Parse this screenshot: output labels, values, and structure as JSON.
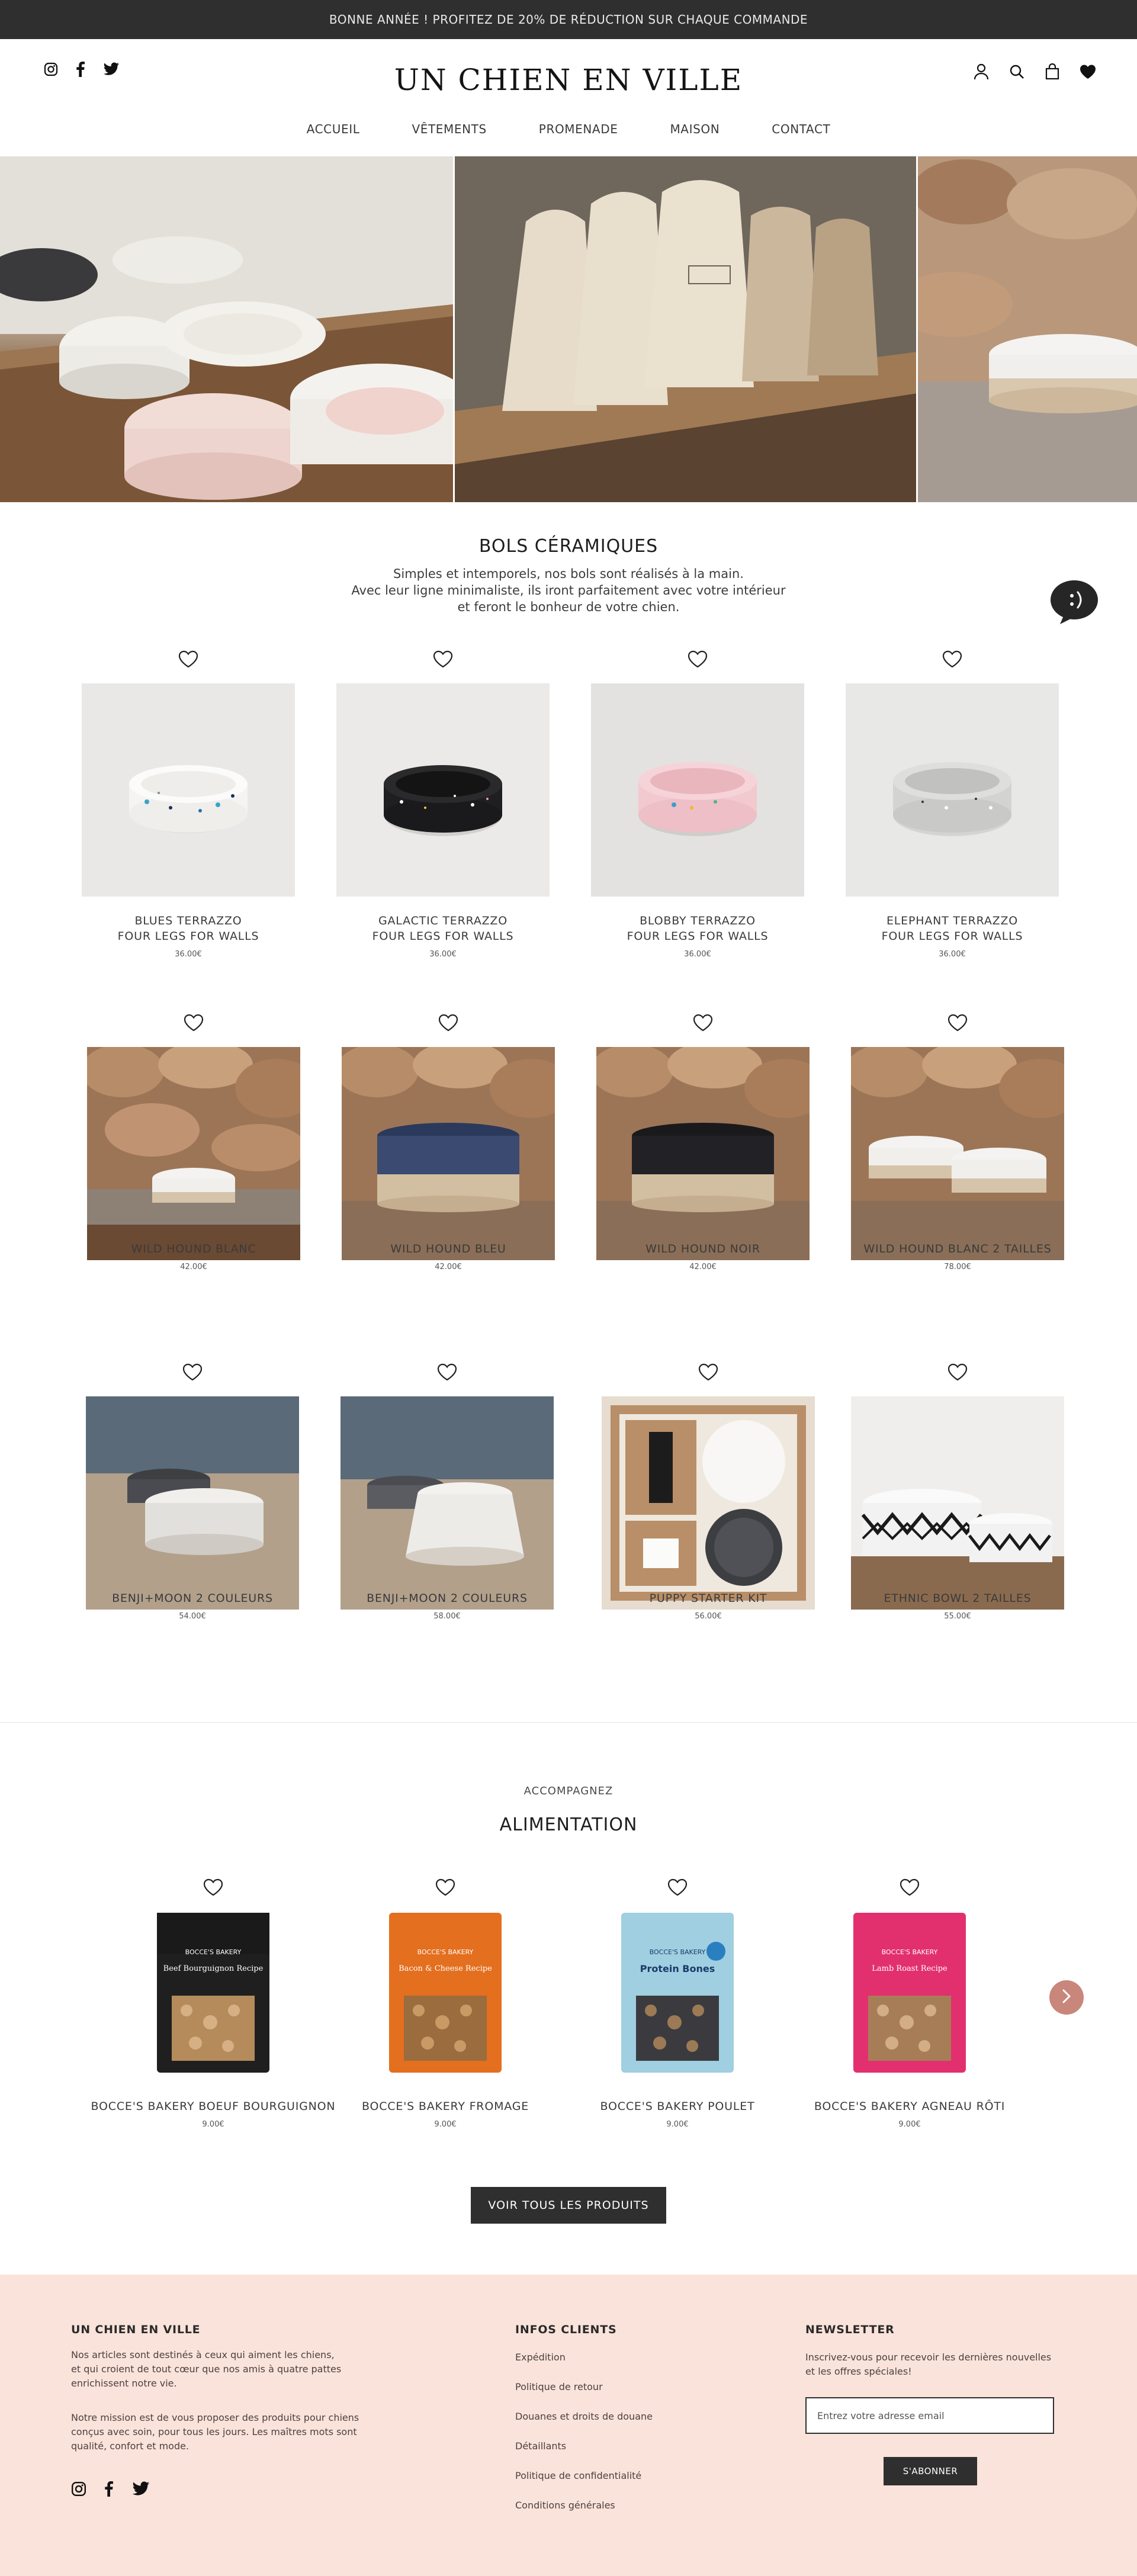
{
  "announcement": "BONNE ANNÉE ! PROFITEZ DE 20% DE RÉDUCTION SUR CHAQUE COMMANDE",
  "header": {
    "logo": "UN CHIEN EN VILLE",
    "social_icons": [
      "instagram-icon",
      "facebook-icon",
      "twitter-icon"
    ],
    "utility_icons": [
      "account-icon",
      "search-icon",
      "cart-icon",
      "wishlist-heart-icon"
    ]
  },
  "nav": [
    "ACCUEIL",
    "VÊTEMENTS",
    "PROMENADE",
    "MAISON",
    "CONTACT"
  ],
  "bowls": {
    "title": "BOLS CÉRAMIQUES",
    "description": [
      "Simples et intemporels, nos bols sont réalisés à la main.",
      "Avec leur ligne minimaliste, ils iront parfaitement avec votre intérieur",
      "et feront le bonheur de votre chien."
    ],
    "products": [
      {
        "name1": "BLUES TERRAZZO",
        "name2": "FOUR LEGS FOR WALLS",
        "price": "36.00€"
      },
      {
        "name1": "GALACTIC TERRAZZO",
        "name2": "FOUR LEGS FOR WALLS",
        "price": "36.00€"
      },
      {
        "name1": "BLOBBY TERRAZZO",
        "name2": "FOUR LEGS FOR WALLS",
        "price": "36.00€"
      },
      {
        "name1": "ELEPHANT TERRAZZO",
        "name2": "FOUR LEGS FOR WALLS",
        "price": "36.00€"
      },
      {
        "name1": "WILD HOUND BLANC",
        "price": "42.00€"
      },
      {
        "name1": "WILD HOUND BLEU",
        "price": "42.00€"
      },
      {
        "name1": "WILD HOUND NOIR",
        "price": "42.00€"
      },
      {
        "name1": "WILD HOUND BLANC 2 TAILLES",
        "price": "78.00€"
      },
      {
        "name1": "BENJI+MOON 2 COULEURS",
        "price": "54.00€"
      },
      {
        "name1": "BENJI+MOON 2 COULEURS",
        "price": "58.00€"
      },
      {
        "name1": "PUPPY STARTER KIT",
        "price": "56.00€"
      },
      {
        "name1": "ETHNIC BOWL 2 TAILLES",
        "price": "55.00€"
      }
    ]
  },
  "food": {
    "label": "ACCOMPAGNEZ",
    "title": "ALIMENTATION",
    "products": [
      {
        "name": "BOCCE'S BAKERY BOEUF BOURGUIGNON",
        "price": "9.00€",
        "pack_brand": "BOCCE'S BAKERY",
        "pack_title": "Beef Bourguignon Recipe",
        "color": "#1e1e1e"
      },
      {
        "name": "BOCCE'S BAKERY FROMAGE",
        "price": "9.00€",
        "pack_brand": "BOCCE'S BAKERY",
        "pack_title": "Bacon & Cheese Recipe",
        "color": "#e36f1f"
      },
      {
        "name": "BOCCE'S BAKERY POULET",
        "price": "9.00€",
        "pack_brand": "BOCCE'S BAKERY",
        "pack_title": "Protein Bones",
        "color": "#9fcfe0"
      },
      {
        "name": "BOCCE'S BAKERY AGNEAU RÔTI",
        "price": "9.00€",
        "pack_brand": "BOCCE'S BAKERY",
        "pack_title": "Lamb Roast Recipe",
        "color": "#e2306f"
      }
    ],
    "button": "VOIR TOUS LES PRODUITS"
  },
  "footer": {
    "about_title": "UN CHIEN EN VILLE",
    "about_p1": [
      "Nos articles sont destinés à ceux qui aiment les chiens,",
      "et qui croient de tout cœur que nos amis à quatre pattes",
      "enrichissent notre vie."
    ],
    "about_p2": [
      "Notre mission est de vous proposer des produits pour chiens",
      "conçus avec soin, pour tous les jours. Les maîtres mots sont",
      "qualité, confort et mode."
    ],
    "info_title": "INFOS CLIENTS",
    "info_links": [
      "Expédition",
      "Politique de retour",
      "Douanes et droits de douane",
      "Détaillants",
      "Politique de confidentialité",
      "Conditions générales"
    ],
    "news_title": "NEWSLETTER",
    "news_text": [
      "Inscrivez-vous pour recevoir les dernières nouvelles",
      "et les offres spéciales!"
    ],
    "news_placeholder": "Entrez votre adresse email",
    "news_button": "S'ABONNER"
  }
}
